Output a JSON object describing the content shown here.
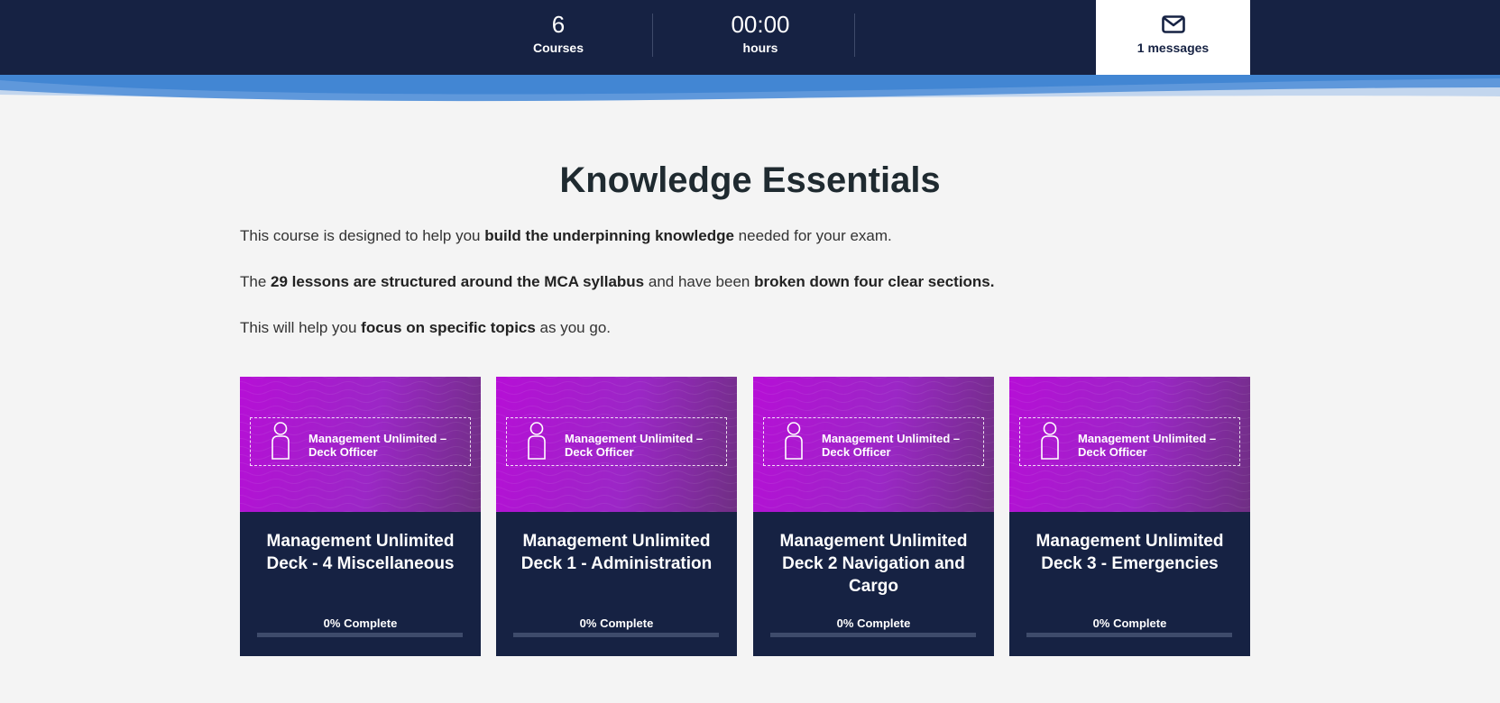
{
  "stats": {
    "courses_count": "6",
    "courses_label": "Courses",
    "hours_value": "00:00",
    "hours_label": "hours"
  },
  "messages": {
    "label": "1 messages",
    "icon": "envelope-icon"
  },
  "colors": {
    "navy": "#162243",
    "wave_blue": "#4286d3",
    "card_purple": "#b60fd6",
    "background": "#f4f4f4"
  },
  "content": {
    "title": "Knowledge Essentials",
    "p1_start": "This course is designed to help you ",
    "p1_bold": "build the underpinning knowledge",
    "p1_end": " needed for your exam.",
    "p2_start": "The ",
    "p2_bold1": "29 lessons are structured around the MCA syllabus",
    "p2_mid": " and have been ",
    "p2_bold2": "broken down four clear sections.",
    "p3_start": "This will help you ",
    "p3_bold": "focus on specific topics",
    "p3_end": " as you go."
  },
  "courses": [
    {
      "image_label": "Management Unlimited – Deck Officer",
      "title": "Management Unlimited Deck - 4 Miscellaneous",
      "progress_label": "0% Complete",
      "progress": 0
    },
    {
      "image_label": "Management Unlimited – Deck Officer",
      "title": "Management Unlimited Deck 1 - Administration",
      "progress_label": "0% Complete",
      "progress": 0
    },
    {
      "image_label": "Management Unlimited – Deck Officer",
      "title": "Management Unlimited Deck 2 Navigation and Cargo",
      "progress_label": "0% Complete",
      "progress": 0
    },
    {
      "image_label": "Management Unlimited – Deck Officer",
      "title": "Management Unlimited Deck 3 - Emergencies",
      "progress_label": "0% Complete",
      "progress": 0
    }
  ]
}
